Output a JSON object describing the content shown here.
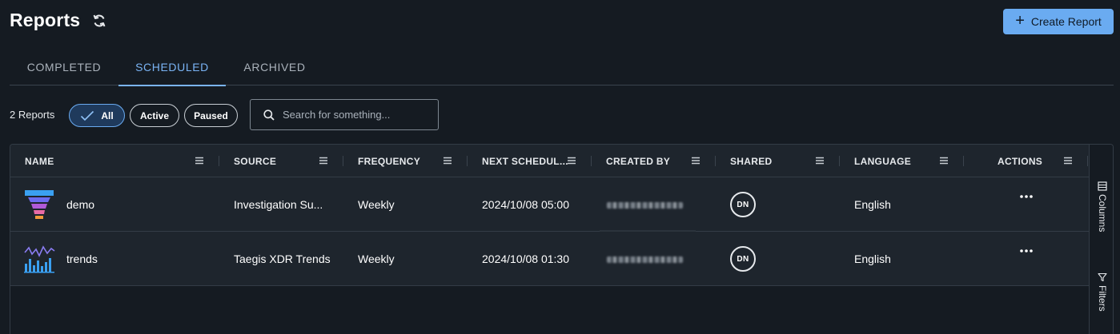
{
  "header": {
    "title": "Reports",
    "create_label": "Create Report",
    "accent": "#6aabf1"
  },
  "tabs": [
    {
      "label": "COMPLETED",
      "active": false
    },
    {
      "label": "SCHEDULED",
      "active": true
    },
    {
      "label": "ARCHIVED",
      "active": false
    }
  ],
  "filters": {
    "count_label": "2 Reports",
    "chips": [
      {
        "label": "All",
        "selected": true
      },
      {
        "label": "Active",
        "selected": false
      },
      {
        "label": "Paused",
        "selected": false
      }
    ],
    "search_placeholder": "Search for something..."
  },
  "table": {
    "columns": [
      "NAME",
      "SOURCE",
      "FREQUENCY",
      "NEXT SCHEDUL...",
      "CREATED BY",
      "SHARED",
      "LANGUAGE",
      "ACTIONS"
    ],
    "rows": [
      {
        "icon": "funnel-chart-icon",
        "name": "demo",
        "source": "Investigation Su...",
        "frequency": "Weekly",
        "next_scheduled": "2024/10/08 05:00",
        "shared_initials": "DN",
        "language": "English"
      },
      {
        "icon": "trend-chart-icon",
        "name": "trends",
        "source": "Taegis XDR Trends",
        "frequency": "Weekly",
        "next_scheduled": "2024/10/08 01:30",
        "shared_initials": "DN",
        "language": "English"
      }
    ]
  },
  "side_panel": {
    "columns_label": "Columns",
    "filters_label": "Filters"
  }
}
